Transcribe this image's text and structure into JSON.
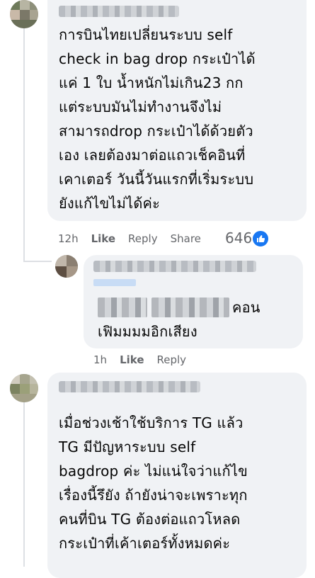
{
  "comments": [
    {
      "text": "การบินไทยเปลี่ยนระบบ self\ncheck in bag drop กระเป๋าได้\nแค่ 1 ใบ น้ำหนักไม่เกิน23 กก\nแต่ระบบมันไม่ทำงานจึงไม่\nสามารถdrop กระเป๋าได้ด้วยตัว\nเอง เลยต้องมาต่อแถวเช็คอินที่\nเคาเตอร์ วันนี้วันแรกที่เริ่มระบบ\nยังแก้ไขไม่ได้ค่ะ",
      "time": "12h",
      "like_label": "Like",
      "reply_label": "Reply",
      "share_label": "Share",
      "reaction_count": "646"
    },
    {
      "text_line1_visible": "คอน",
      "text_line2": "เฟิมมมมอิกเสียง",
      "time": "1h",
      "like_label": "Like",
      "reply_label": "Reply"
    },
    {
      "text": "เมื่อช่วงเช้าใช้บริการ TG แล้ว\nTG มีปัญหาระบบ self\nbagdrop ค่ะ ไม่แน่ใจว่าแก้ไข\nเรื่องนี้รึยัง ถ้ายังน่าจะเพราะทุก\nคนที่บิน TG ต้องต่อแถวโหลด\nกระเป๋าที่เค้าเตอร์ทั้งหมดค่ะ"
    }
  ],
  "colors": {
    "bubble": "#f0f2f5",
    "meta": "#65676b",
    "like_blue": "#1877f2"
  },
  "icons": {
    "reaction": "like-thumb-icon"
  }
}
